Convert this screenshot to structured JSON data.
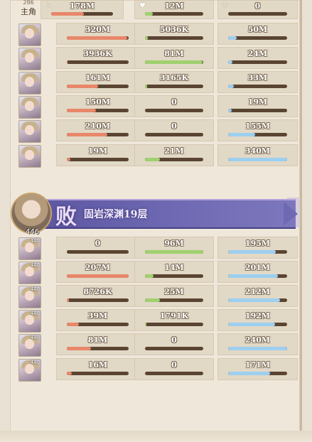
{
  "colors": {
    "damage": "#e8876a",
    "heal": "#9fd16e",
    "tank": "#9dcff0",
    "defeat_banner": "#6f6ab3"
  },
  "top_summary": {
    "hero_count": "286",
    "hero_label": "主角",
    "damage_icon": "crossed-swords-icon",
    "heal_icon": "heart-icon",
    "tank_icon": "shield-icon",
    "damage_total": "178M",
    "heal_total": "12M",
    "tank_total": "0"
  },
  "team_a": [
    {
      "damage": "320M",
      "heal": "5036K",
      "tank": "50M",
      "damage_fill": 0.98,
      "heal_fill": 0.05,
      "tank_fill": 0.15
    },
    {
      "damage": "3936K",
      "heal": "81M",
      "tank": "24M",
      "damage_fill": 0.01,
      "heal_fill": 0.99,
      "tank_fill": 0.07
    },
    {
      "damage": "161M",
      "heal": "3165K",
      "tank": "33M",
      "damage_fill": 0.5,
      "heal_fill": 0.04,
      "tank_fill": 0.1
    },
    {
      "damage": "150M",
      "heal": "0",
      "tank": "19M",
      "damage_fill": 0.47,
      "heal_fill": 0,
      "tank_fill": 0.06
    },
    {
      "damage": "210M",
      "heal": "0",
      "tank": "155M",
      "damage_fill": 0.66,
      "heal_fill": 0,
      "tank_fill": 0.46
    },
    {
      "damage": "19M",
      "heal": "21M",
      "tank": "340M",
      "damage_fill": 0.06,
      "heal_fill": 0.26,
      "tank_fill": 1
    }
  ],
  "defeat_banner": {
    "result": "败",
    "stage": "固岩深渊19层",
    "level": "446"
  },
  "team_b": [
    {
      "lvl": "440",
      "damage": "0",
      "heal": "96M",
      "tank": "195M",
      "damage_fill": 0,
      "heal_fill": 1,
      "tank_fill": 0.81
    },
    {
      "lvl": "440",
      "damage": "207M",
      "heal": "14M",
      "tank": "201M",
      "damage_fill": 1,
      "heal_fill": 0.15,
      "tank_fill": 0.84
    },
    {
      "lvl": "440",
      "damage": "8726K",
      "heal": "25M",
      "tank": "212M",
      "damage_fill": 0.04,
      "heal_fill": 0.26,
      "tank_fill": 0.88
    },
    {
      "lvl": "440",
      "damage": "39M",
      "heal": "1791K",
      "tank": "192M",
      "damage_fill": 0.19,
      "heal_fill": 0.02,
      "tank_fill": 0.8
    },
    {
      "lvl": "440",
      "damage": "81M",
      "heal": "0",
      "tank": "240M",
      "damage_fill": 0.39,
      "heal_fill": 0,
      "tank_fill": 1
    },
    {
      "lvl": "440",
      "damage": "16M",
      "heal": "0",
      "tank": "171M",
      "damage_fill": 0.08,
      "heal_fill": 0,
      "tank_fill": 0.71
    }
  ]
}
